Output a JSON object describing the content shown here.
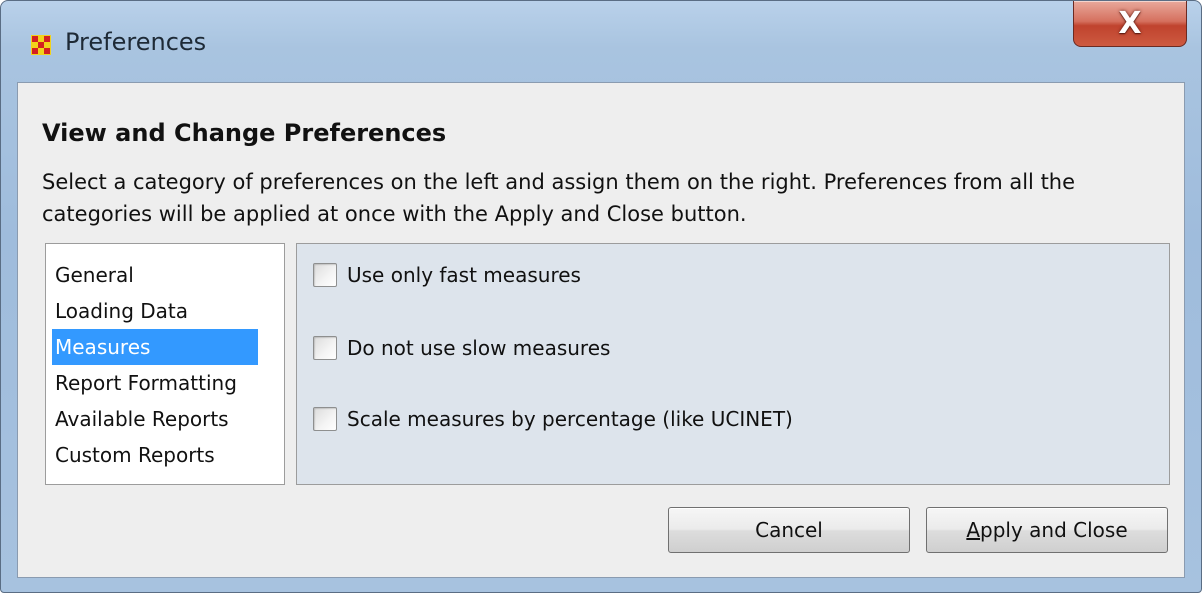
{
  "window": {
    "title": "Preferences",
    "close_label": "X"
  },
  "content": {
    "heading": "View and Change Preferences",
    "description": "Select a category of preferences on the left and assign them on the right. Preferences from all the categories will be applied at once with the Apply and Close button."
  },
  "categories": {
    "items": [
      {
        "label": "General"
      },
      {
        "label": "Loading Data"
      },
      {
        "label": "Measures"
      },
      {
        "label": "Report Formatting"
      },
      {
        "label": "Available Reports"
      },
      {
        "label": "Custom Reports"
      }
    ],
    "selected": "Measures"
  },
  "options": [
    {
      "label": "Use only fast measures",
      "checked": false
    },
    {
      "label": "Do not use slow measures",
      "checked": false
    },
    {
      "label": "Scale measures by percentage (like UCINET)",
      "checked": false
    }
  ],
  "buttons": {
    "cancel": "Cancel",
    "apply_mnemonic": "A",
    "apply_rest": "pply and Close"
  },
  "colors": {
    "selection": "#3399ff",
    "panel_bg": "#dde4ec",
    "close_button": "#c0432e"
  },
  "icons": {
    "app": "grid-network-icon",
    "close": "close-icon",
    "checkbox": "checkbox-unchecked-icon"
  }
}
